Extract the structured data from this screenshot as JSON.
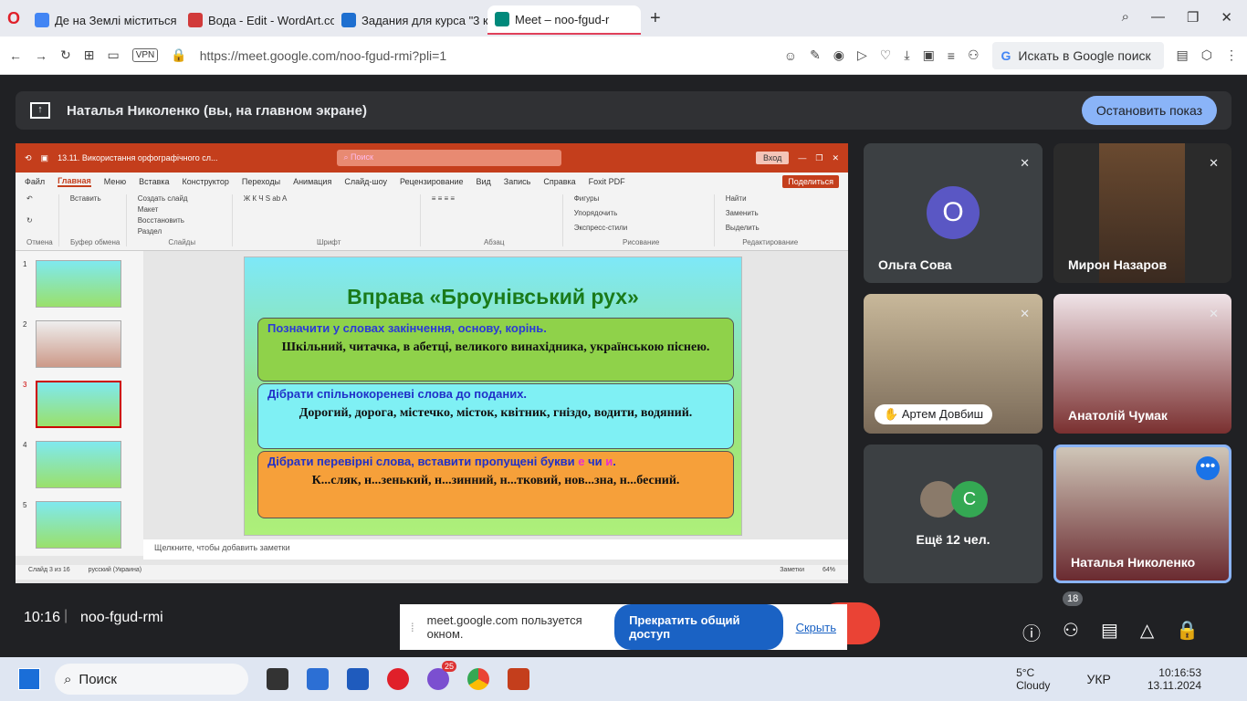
{
  "browser": {
    "tabs": [
      {
        "title": "Де на Землі міститься во",
        "fav": "#4285f4"
      },
      {
        "title": "Вода - Edit - WordArt.com",
        "fav": "#d13a3a"
      },
      {
        "title": "Задания для курса \"3 кла",
        "fav": "#1e6fd0"
      },
      {
        "title": "Meet – noo-fgud-r",
        "fav": "#00897b",
        "active": true
      }
    ],
    "url": "https://meet.google.com/noo-fgud-rmi?pli=1",
    "vpn": "VPN",
    "search_placeholder": "Искать в Google поиск"
  },
  "meet": {
    "presenter": "Наталья Николенко (вы, на главном экране)",
    "stop_label": "Остановить показ",
    "time": "10:16",
    "code": "noo-fgud-rmi",
    "people_count": "18",
    "participants": [
      {
        "name": "Ольга Сова",
        "initial": "О"
      },
      {
        "name": "Мирон Назаров"
      },
      {
        "name": "Артем Довбиш"
      },
      {
        "name": "Анатолій Чумак"
      },
      {
        "name": "Ещё 12 чел.",
        "initial": "С"
      },
      {
        "name": "Наталья Николенко"
      }
    ],
    "share_notice": "meet.google.com пользуется окном.",
    "stop_share": "Прекратить общий доступ",
    "hide": "Скрыть"
  },
  "ppt": {
    "title": "13.11. Використання орфографічного сл...",
    "search": "Поиск",
    "signin": "Вход",
    "menu": [
      "Файл",
      "Главная",
      "Меню",
      "Вставка",
      "Конструктор",
      "Переходы",
      "Анимация",
      "Слайд-шоу",
      "Рецензирование",
      "Вид",
      "Запись",
      "Справка",
      "Foxit PDF"
    ],
    "share": "Поделиться",
    "groups": [
      "Отмена",
      "Буфер обмена",
      "Слайды",
      "Шрифт",
      "Абзац",
      "Рисование",
      "Редактирование"
    ],
    "ribbon": {
      "paste": "Вставить",
      "create": "Создать слайд",
      "layout": "Макет",
      "restore": "Восстановить",
      "section": "Раздел",
      "shapes": "Фигуры",
      "arrange": "Упорядочить",
      "express": "Экспресс-стили",
      "find": "Найти",
      "replace": "Заменить",
      "select": "Выделить"
    },
    "slide": {
      "title": "Вправа «Броунівський рух»",
      "q1": "Позначити у словах закінчення, основу, корінь.",
      "a1": "Шкільний, читачка, в абетці, великого винахідника, українською піснею.",
      "q2": "Дібрати спільнокореневі слова до поданих.",
      "a2": "Дорогий, дорога, містечко, місток, квітник, гніздо, водити, водяний.",
      "q3": "Дібрати перевірні слова, вставити пропущені букви",
      "q3_e": "е",
      "q3_or": "чи",
      "q3_y": "и",
      "a3": "К...сляк, н...зенький, н...зинний, н...тковий, нов...зна, н...бесний."
    },
    "notes": "Щелкните, чтобы добавить заметки",
    "status_slide": "Слайд 3 из 16",
    "status_lang": "русский (Украина)",
    "status_notes": "Заметки",
    "zoom": "64%",
    "thumb_nums": [
      "1",
      "2",
      "3",
      "4",
      "5"
    ]
  },
  "taskbar": {
    "search": "Поиск",
    "temp": "5°C",
    "weather": "Cloudy",
    "lang": "УКР",
    "time": "10:16:53",
    "date": "13.11.2024",
    "viber_badge": "25"
  }
}
